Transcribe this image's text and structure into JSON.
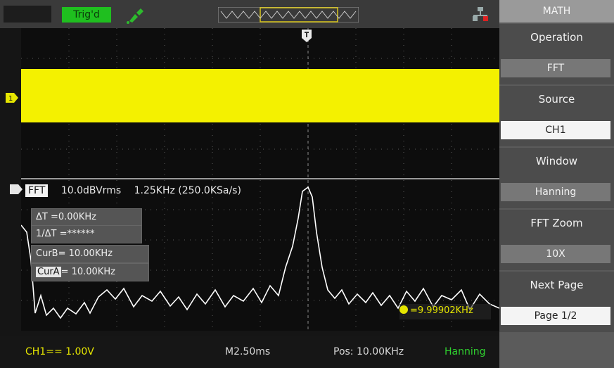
{
  "status_bar": {
    "trigger_status": "Trig'd"
  },
  "fft_header": {
    "label": "FFT",
    "scale": "10.0dBVrms",
    "frequency": "1.25KHz (250.0KSa/s)"
  },
  "cursors": {
    "delta_t": "ΔT =0.00KHz",
    "inv_delta_t": "1/ΔT =******",
    "cur_b": "CurB= 10.00KHz",
    "cur_a_label": "CurA",
    "cur_a_value": "= 10.00KHz"
  },
  "freq_readout": {
    "value": "=9.99902KHz"
  },
  "bottom_bar": {
    "ch1": "CH1== 1.00V",
    "timebase": "M2.50ms",
    "position": "Pos: 10.00KHz",
    "window": "Hanning"
  },
  "menu": {
    "title": "MATH",
    "items": [
      {
        "caption": "Operation",
        "value": "FFT"
      },
      {
        "caption": "Source",
        "value": "CH1"
      },
      {
        "caption": "Window",
        "value": "Hanning"
      },
      {
        "caption": "FFT Zoom",
        "value": "10X"
      },
      {
        "caption": "Next Page",
        "value": "Page 1/2"
      }
    ]
  },
  "colors": {
    "ch1_trace": "#f4f100",
    "fft_trace": "#ffffff",
    "trig_ok": "#1fbf1f",
    "menu_bg": "#4c4c4c"
  }
}
